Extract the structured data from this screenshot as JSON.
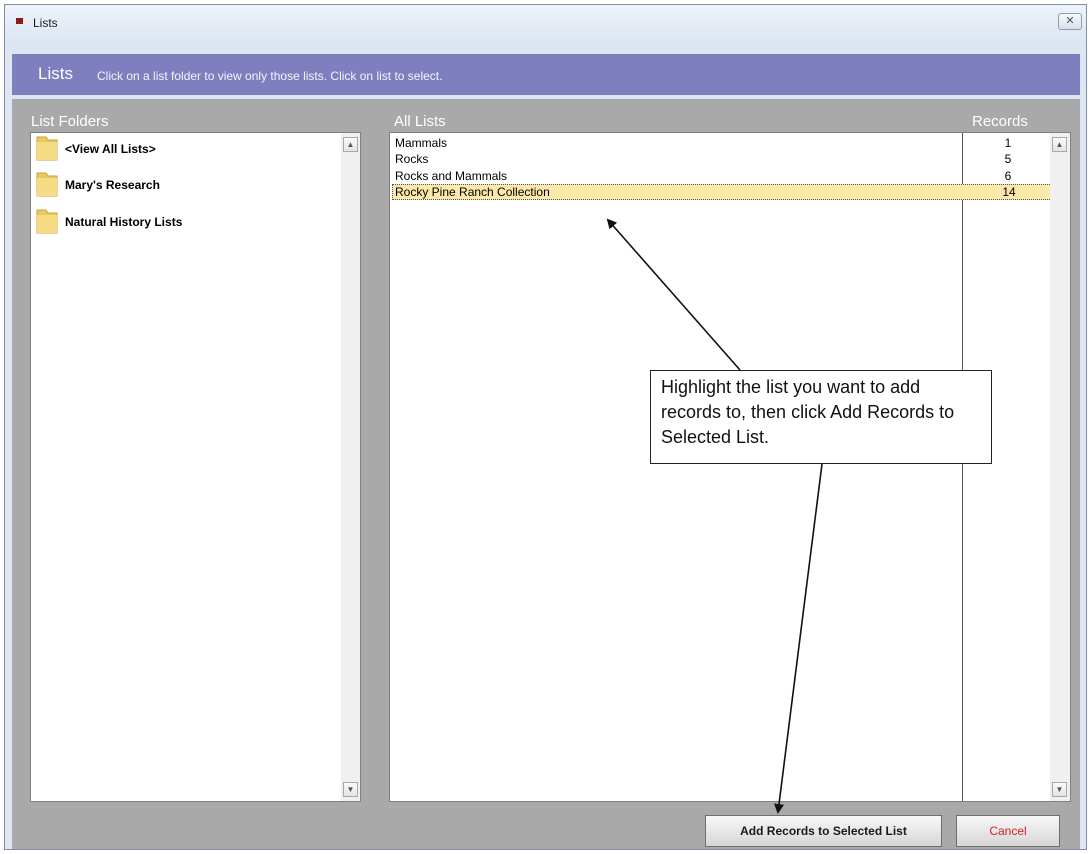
{
  "window": {
    "title": "Lists",
    "close_glyph": "✕"
  },
  "header": {
    "title": "Lists",
    "description": "Click on a list folder to view only those lists. Click on list to select."
  },
  "folders_panel": {
    "heading": "List Folders",
    "items": [
      {
        "label": "<View All Lists>",
        "icon": "folder-icon"
      },
      {
        "label": "Mary's Research",
        "icon": "folder-icon"
      },
      {
        "label": "Natural History Lists",
        "icon": "folder-icon"
      }
    ]
  },
  "lists_panel": {
    "heading": "All Lists",
    "records_heading": "Records",
    "rows": [
      {
        "name": "Mammals",
        "records": "1"
      },
      {
        "name": "Rocks",
        "records": "5"
      },
      {
        "name": "Rocks and Mammals",
        "records": "6"
      },
      {
        "name": "Rocky Pine Ranch Collection",
        "records": "14",
        "selected": true
      }
    ]
  },
  "scroll": {
    "up_glyph": "▲",
    "down_glyph": "▼"
  },
  "buttons": {
    "add_records": "Add Records to Selected List",
    "cancel": "Cancel"
  },
  "annotation": {
    "callout": "Highlight the list you want to add records to, then click Add Records to Selected List."
  },
  "colors": {
    "header_bg": "#7f7fbf",
    "body_bg": "#a9a9a9",
    "selected_row": "#fce8a8",
    "cancel_text": "#d42020",
    "app_icon": "#8b1a1a"
  }
}
